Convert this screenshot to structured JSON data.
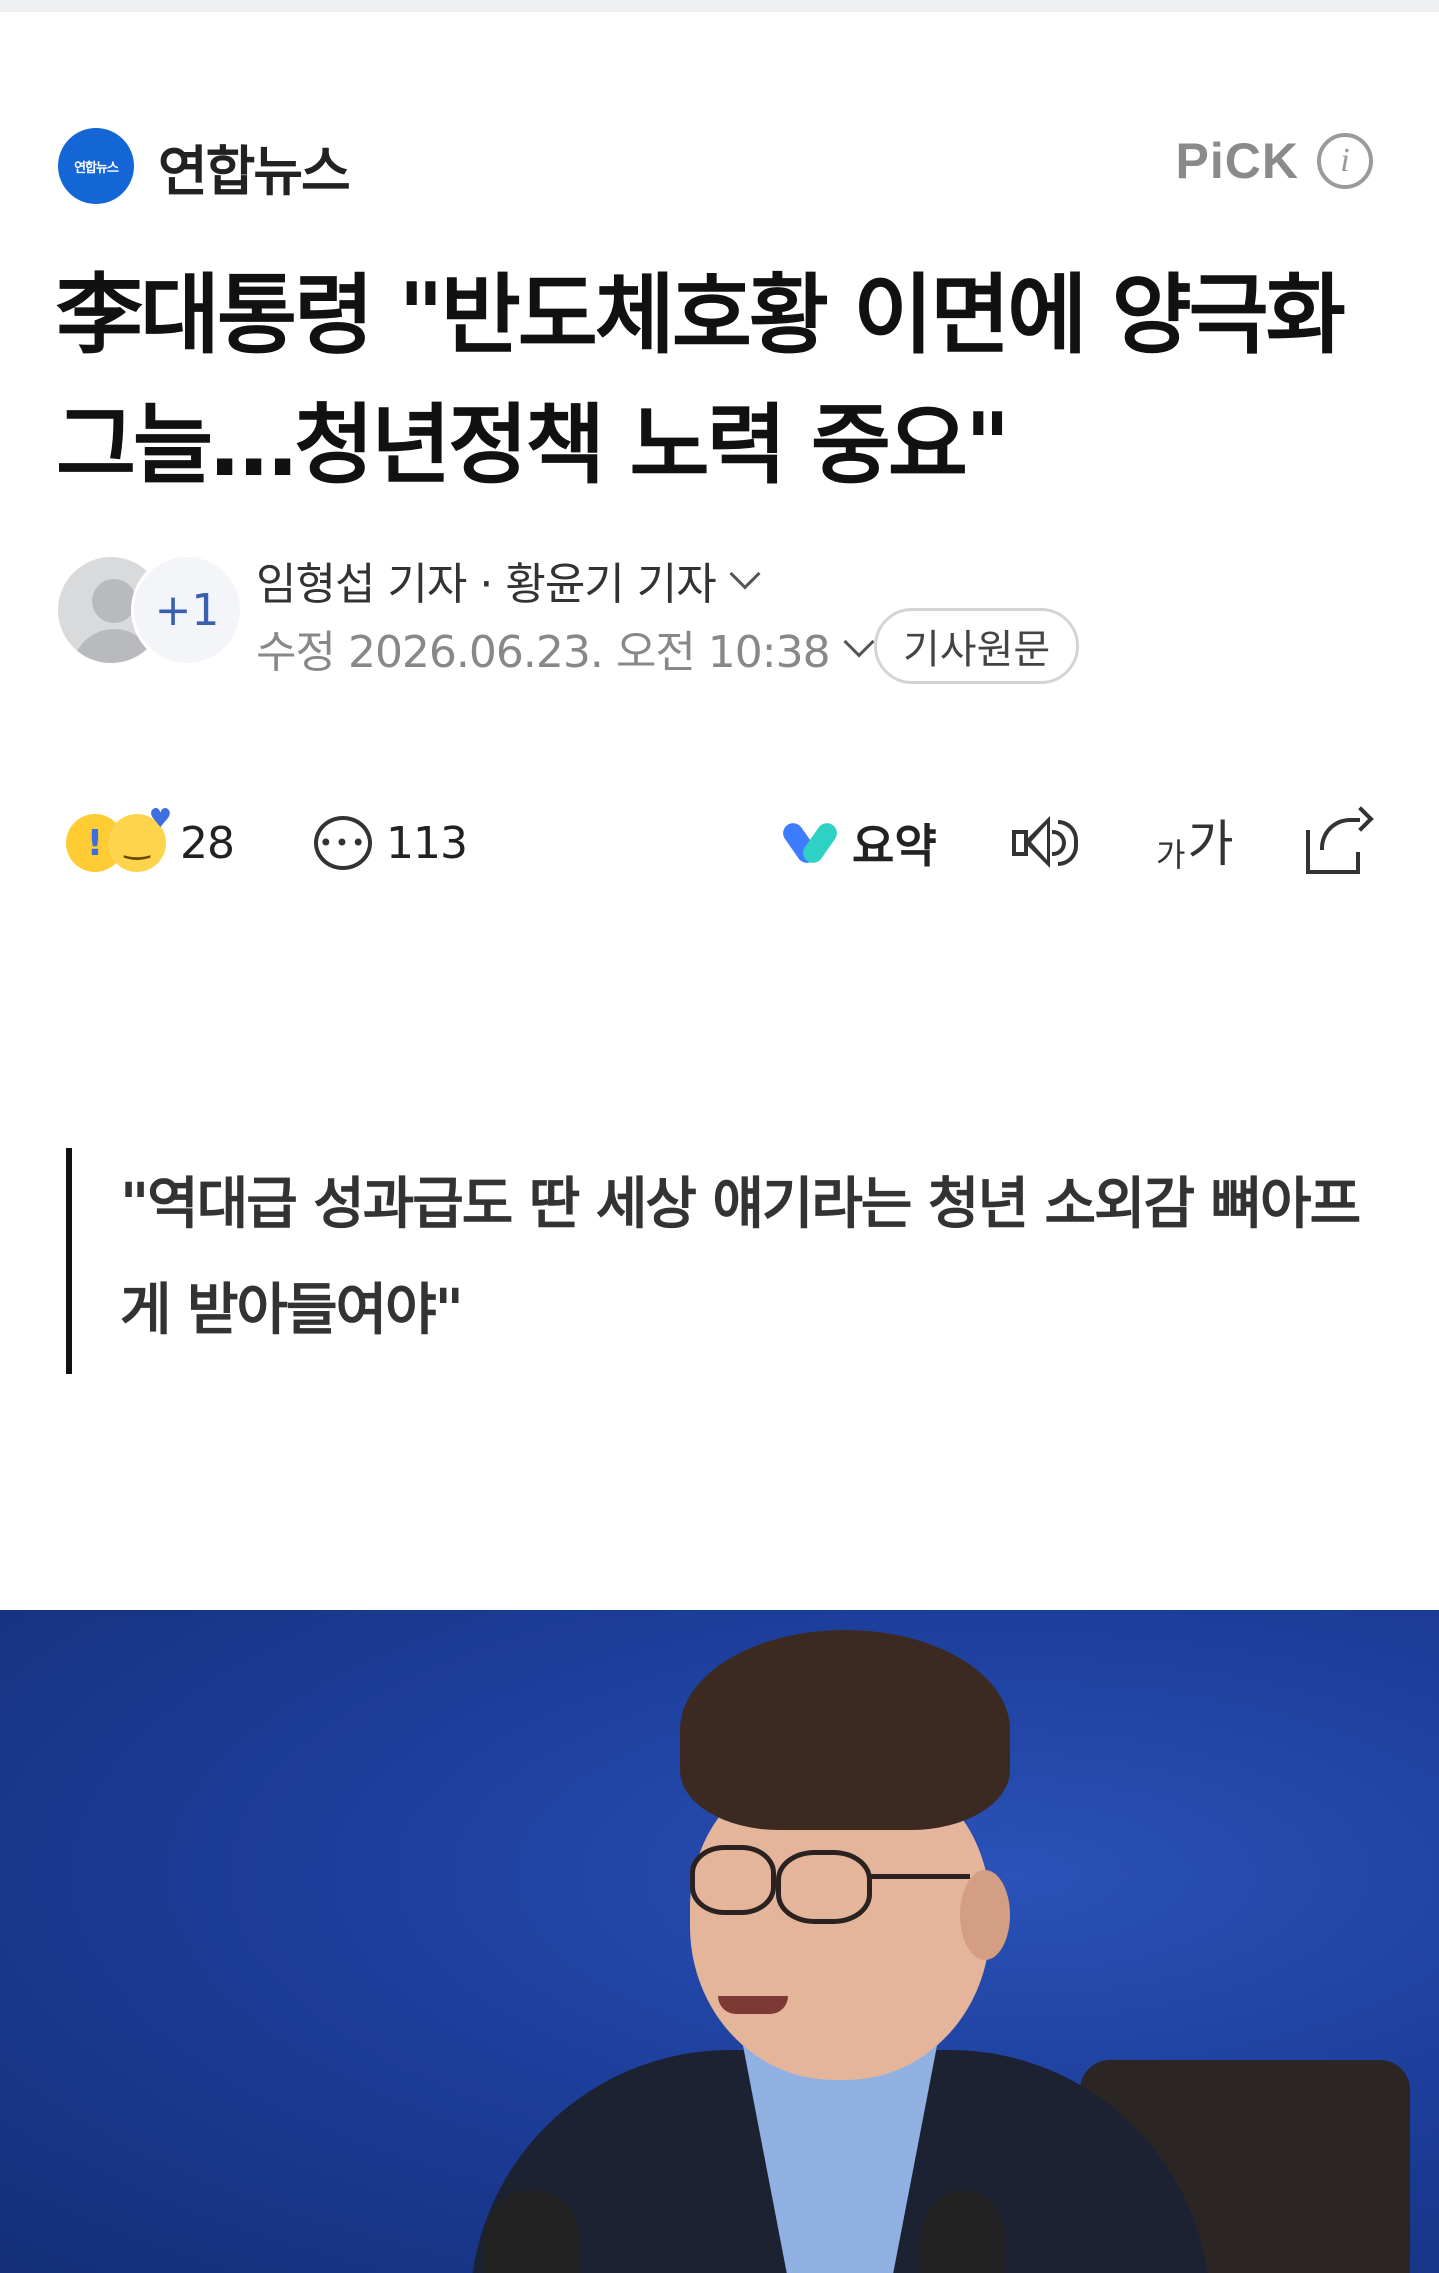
{
  "press": {
    "logo_text": "연합뉴스",
    "name": "연합뉴스",
    "pick_label": "PiCK",
    "info_icon": "info-icon"
  },
  "article": {
    "title": "李대통령 \"반도체호황 이면에 양극화 그늘…청년정책 노력 중요\"",
    "reporters": "임형섭 기자 · 황윤기 기자",
    "extra_reporters": "+1",
    "dateline": "수정 2026.06.23. 오전 10:38",
    "original_button": "기사원문",
    "quote": "\"역대급 성과급도 딴 세상 얘기라는 청년 소외감 뼈아프게 받아들여야\""
  },
  "actions": {
    "reaction_count": "28",
    "comment_count": "113",
    "summary_label": "요약",
    "font_small": "가",
    "font_big": "가",
    "icons": [
      "reaction-emoji-icon",
      "comment-icon",
      "summary-icon",
      "speaker-icon",
      "font-size-icon",
      "share-icon"
    ]
  },
  "colors": {
    "press_blue": "#1466d6",
    "photo_background": "#1d3f9c"
  }
}
